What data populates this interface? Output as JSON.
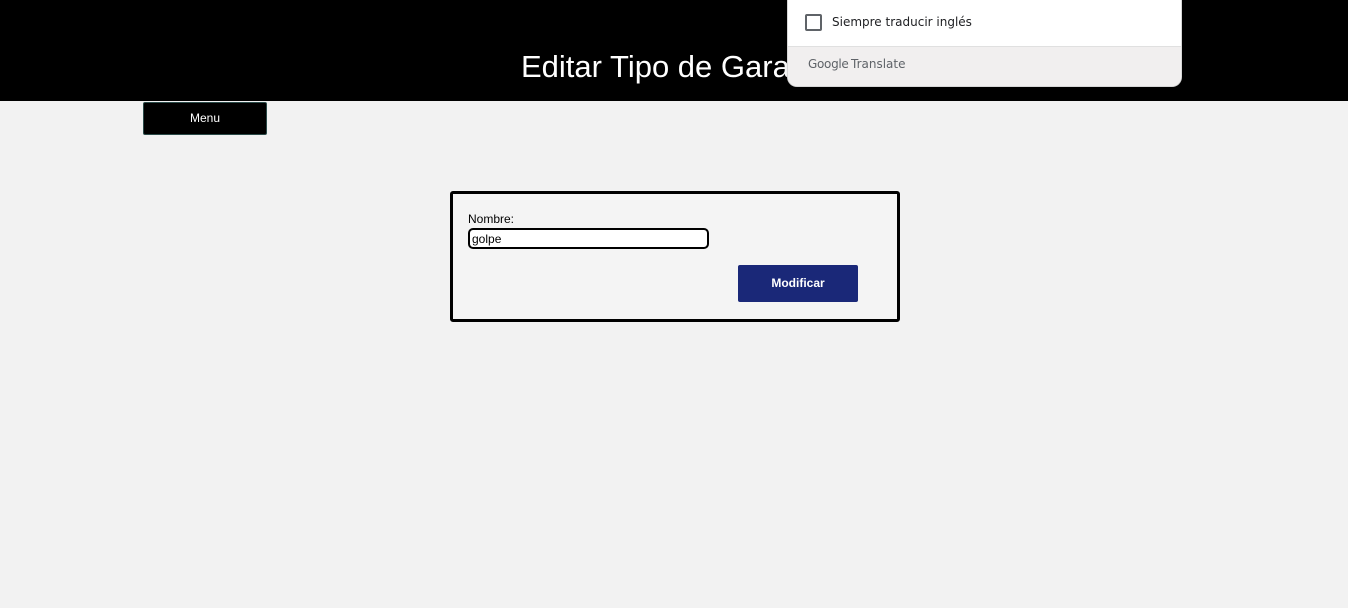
{
  "header": {
    "title": "Editar Tipo de Garan"
  },
  "nav": {
    "menu_label": "Menu"
  },
  "form": {
    "name_label": "Nombre:",
    "name_value": "golpe",
    "submit_label": "Modificar"
  },
  "translate_popup": {
    "always_translate_label": "Siempre traducir inglés",
    "always_translate_checked": false,
    "brand_google": "Google",
    "brand_translate": "Translate"
  },
  "colors": {
    "header_bg": "#000000",
    "page_bg": "#f2f2f2",
    "submit_bg": "#1a2878",
    "menu_bg": "#000000"
  }
}
